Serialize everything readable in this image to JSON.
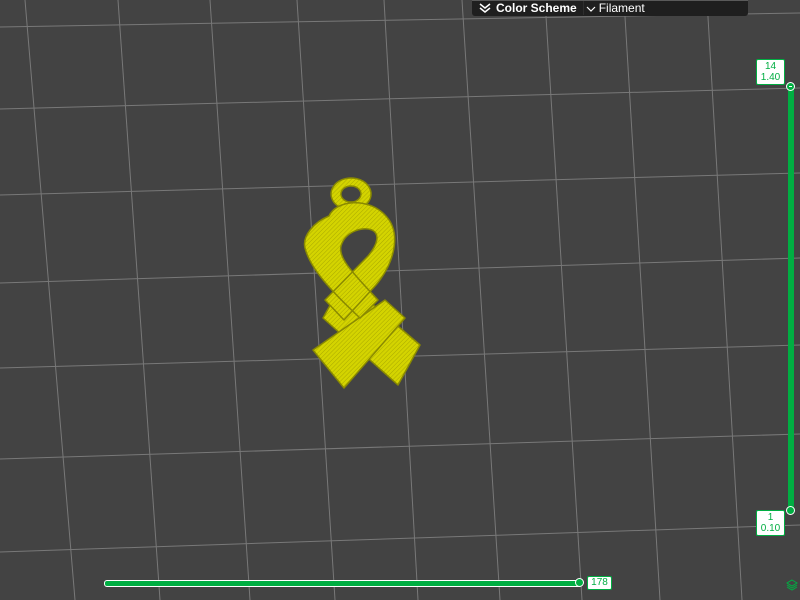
{
  "color_scheme": {
    "label": "Color Scheme",
    "selected": "Filament"
  },
  "layer_slider": {
    "top_layer": "14",
    "top_height": "1.40",
    "bottom_layer": "1",
    "bottom_height": "0.10"
  },
  "move_slider": {
    "value": "178",
    "fraction": 1.0
  },
  "colors": {
    "background": "#434343",
    "grid": "#8a8a8a",
    "accent": "#00ae42",
    "filament": "#d9d900",
    "panel": "#1f1f1f"
  },
  "icons": {
    "collapse": "double-chevron-down-icon",
    "dropdown": "chevron-down-icon",
    "layers": "layers-icon"
  }
}
